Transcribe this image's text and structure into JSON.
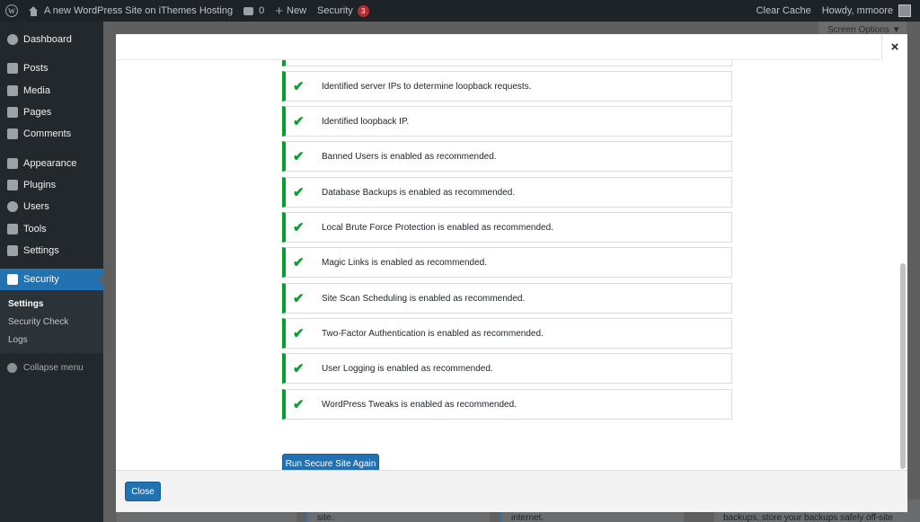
{
  "admin_bar": {
    "site_name": "A new WordPress Site on iThemes Hosting",
    "comments_count": "0",
    "new_label": "New",
    "security_label": "Security",
    "security_badge": "3",
    "clear_cache": "Clear Cache",
    "howdy": "Howdy, mmoore"
  },
  "sidebar": {
    "items": [
      {
        "label": "Dashboard",
        "icon": "dashboard-icon"
      },
      {
        "label": "Posts",
        "icon": "pin-icon"
      },
      {
        "label": "Media",
        "icon": "media-icon"
      },
      {
        "label": "Pages",
        "icon": "page-icon"
      },
      {
        "label": "Comments",
        "icon": "comment-icon"
      },
      {
        "label": "Appearance",
        "icon": "brush-icon"
      },
      {
        "label": "Plugins",
        "icon": "plug-icon"
      },
      {
        "label": "Users",
        "icon": "user-icon"
      },
      {
        "label": "Tools",
        "icon": "wrench-icon"
      },
      {
        "label": "Settings",
        "icon": "settings-icon"
      },
      {
        "label": "Security",
        "icon": "shield-icon"
      }
    ],
    "submenu": [
      "Settings",
      "Security Check",
      "Logs"
    ],
    "collapse": "Collapse menu"
  },
  "screen_options": "Screen Options ▼",
  "modal": {
    "close_x": "×",
    "notices": [
      "Identified server IPs to determine loopback requests.",
      "Identified loopback IP.",
      "Banned Users is enabled as recommended.",
      "Database Backups is enabled as recommended.",
      "Local Brute Force Protection is enabled as recommended.",
      "Magic Links is enabled as recommended.",
      "Site Scan Scheduling is enabled as recommended.",
      "Two-Factor Authentication is enabled as recommended.",
      "User Logging is enabled as recommended.",
      "WordPress Tweaks is enabled as recommended."
    ],
    "run_button": "Run Secure Site Again",
    "close_button": "Close"
  },
  "background": {
    "strip1": "site.",
    "strip2": "internet.",
    "strip3": "backups, store your backups safely off-site"
  },
  "colors": {
    "accent": "#2271b1",
    "success": "#00a32a",
    "admin_bar": "#1d2327",
    "badge": "#b32d2e"
  }
}
